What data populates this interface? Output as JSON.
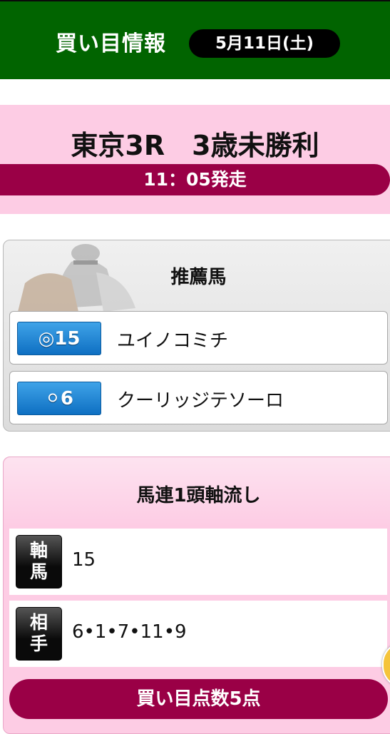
{
  "header": {
    "title": "買い目情報",
    "date": "5月11日(土)"
  },
  "race": {
    "title": "東京3R　3歳未勝利",
    "start_time": "11：05発走"
  },
  "recommended": {
    "heading": "推薦馬",
    "horses": [
      {
        "mark": "◎15",
        "name": "ユイノコミチ"
      },
      {
        "mark": "⚪6",
        "name": "クーリッジテソーロ"
      }
    ]
  },
  "bet": {
    "heading": "馬連1頭軸流し",
    "rows": [
      {
        "role_top": "軸",
        "role_bottom": "馬",
        "value": "15"
      },
      {
        "role_top": "相",
        "role_bottom": "手",
        "value": "6•1•7•11•9"
      }
    ],
    "points_label": "買い目点数5点"
  },
  "colors": {
    "header_green": "#016400",
    "accent_magenta": "#9a0046",
    "panel_pink": "#fdcce4",
    "badge_blue": "#0e6fc2"
  }
}
